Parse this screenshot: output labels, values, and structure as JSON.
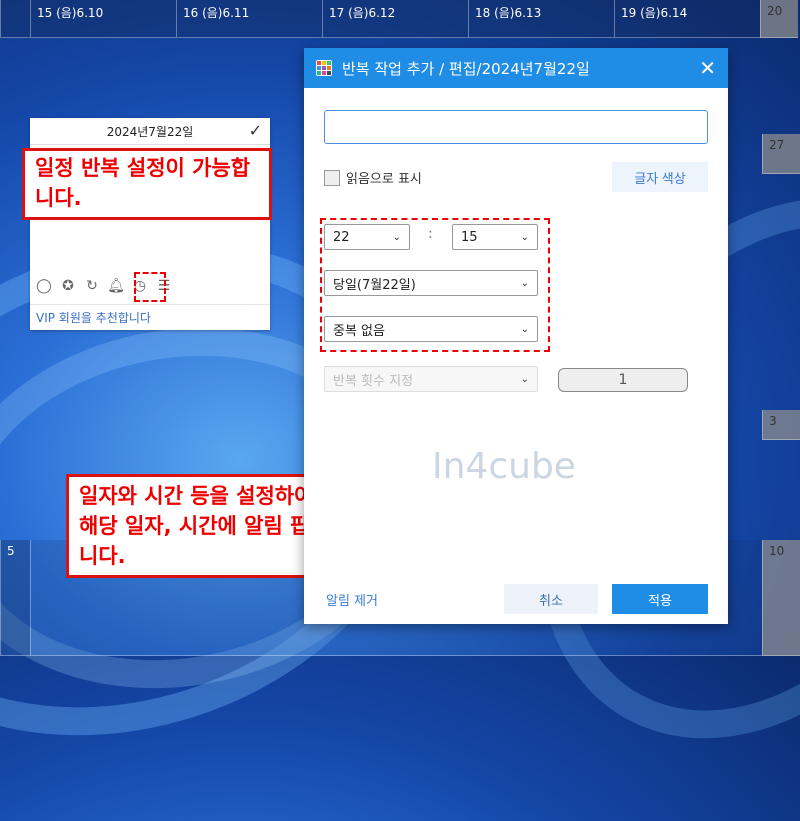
{
  "calendar": {
    "top_row": [
      "15 (음)6.10",
      "16 (음)6.11",
      "17 (음)6.12",
      "18 (음)6.13",
      "19 (음)6.14",
      "20"
    ],
    "mid_row1_right": "27",
    "mid_row2_right": "3",
    "bottom_row": [
      "5",
      "",
      "",
      "",
      "",
      "10"
    ]
  },
  "widget": {
    "date": "2024년7월22일",
    "footer": "VIP 회원을 추천합니다"
  },
  "callouts": {
    "top": "일정 반복 설정이 가능합니다.",
    "bottom": "일자와 시간 등을 설정하여 적용하면 해당 일자, 시간에 알림 팝업창이 뜹니다."
  },
  "dialog": {
    "title": "반복 작업 추가 / 편집/2024년7월22일",
    "input_value": "",
    "show_as_read": "읽음으로 표시",
    "font_color_btn": "글자 색상",
    "hour": "22",
    "minute": "15",
    "day_option": "당일(7월22일)",
    "repeat_option": "중복 없음",
    "repeat_count_option": "반복 횟수 지정",
    "repeat_count_value": "1",
    "watermark": "In4cube",
    "remove_alarm": "알림 제거",
    "cancel": "취소",
    "apply": "적용"
  }
}
